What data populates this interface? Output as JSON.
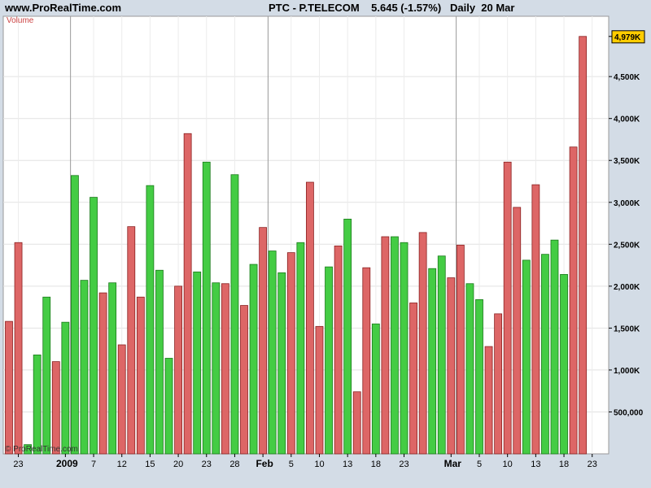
{
  "header": {
    "site": "www.ProRealTime.com",
    "title": "PTC - P.TELECOM    5.645 (-1.57%)   Daily  20 Mar"
  },
  "chart_data": {
    "type": "bar",
    "indicator_label": "Volume",
    "copyright": "© ProRealTime.com",
    "last_value_label": "4,979K",
    "ylim": [
      0,
      5200000
    ],
    "y_ticks": [
      {
        "value": 500000,
        "label": "500,000"
      },
      {
        "value": 1000000,
        "label": "1,000K"
      },
      {
        "value": 1500000,
        "label": "1,500K"
      },
      {
        "value": 2000000,
        "label": "2,000K"
      },
      {
        "value": 2500000,
        "label": "2,500K"
      },
      {
        "value": 3000000,
        "label": "3,000K"
      },
      {
        "value": 3500000,
        "label": "3,500K"
      },
      {
        "value": 4000000,
        "label": "4,000K"
      },
      {
        "value": 4500000,
        "label": "4,500K"
      }
    ],
    "x_ticks": [
      {
        "index": 1,
        "label": "23",
        "major": false
      },
      {
        "index": 6,
        "label": "2009",
        "major": true
      },
      {
        "index": 9,
        "label": "7",
        "major": false
      },
      {
        "index": 12,
        "label": "12",
        "major": false
      },
      {
        "index": 15,
        "label": "15",
        "major": false
      },
      {
        "index": 18,
        "label": "20",
        "major": false
      },
      {
        "index": 21,
        "label": "23",
        "major": false
      },
      {
        "index": 24,
        "label": "28",
        "major": false
      },
      {
        "index": 27,
        "label": "Feb",
        "major": true
      },
      {
        "index": 30,
        "label": "5",
        "major": false
      },
      {
        "index": 33,
        "label": "10",
        "major": false
      },
      {
        "index": 36,
        "label": "13",
        "major": false
      },
      {
        "index": 39,
        "label": "18",
        "major": false
      },
      {
        "index": 42,
        "label": "23",
        "major": false
      },
      {
        "index": 47,
        "label": "Mar",
        "major": true
      },
      {
        "index": 50,
        "label": "5",
        "major": false
      },
      {
        "index": 53,
        "label": "10",
        "major": false
      },
      {
        "index": 56,
        "label": "13",
        "major": false
      },
      {
        "index": 59,
        "label": "18",
        "major": false
      },
      {
        "index": 62,
        "label": "23",
        "major": false
      }
    ],
    "separators": [
      6,
      27,
      47
    ],
    "colors": {
      "up": "#44cc44",
      "down": "#dd6666",
      "up_edge": "#1a7a1a",
      "down_edge": "#8a2020"
    },
    "bars": [
      {
        "v": 1580000,
        "d": "down"
      },
      {
        "v": 2520000,
        "d": "down"
      },
      {
        "v": 110000,
        "d": "up"
      },
      {
        "v": 1180000,
        "d": "up"
      },
      {
        "v": 1870000,
        "d": "up"
      },
      {
        "v": 1100000,
        "d": "down"
      },
      {
        "v": 1570000,
        "d": "up"
      },
      {
        "v": 3320000,
        "d": "up"
      },
      {
        "v": 2070000,
        "d": "up"
      },
      {
        "v": 3060000,
        "d": "up"
      },
      {
        "v": 1920000,
        "d": "down"
      },
      {
        "v": 2040000,
        "d": "up"
      },
      {
        "v": 1300000,
        "d": "down"
      },
      {
        "v": 2710000,
        "d": "down"
      },
      {
        "v": 1870000,
        "d": "down"
      },
      {
        "v": 3200000,
        "d": "up"
      },
      {
        "v": 2190000,
        "d": "up"
      },
      {
        "v": 1140000,
        "d": "up"
      },
      {
        "v": 2000000,
        "d": "down"
      },
      {
        "v": 3820000,
        "d": "down"
      },
      {
        "v": 2170000,
        "d": "up"
      },
      {
        "v": 3480000,
        "d": "up"
      },
      {
        "v": 2040000,
        "d": "up"
      },
      {
        "v": 2030000,
        "d": "down"
      },
      {
        "v": 3330000,
        "d": "up"
      },
      {
        "v": 1770000,
        "d": "down"
      },
      {
        "v": 2260000,
        "d": "up"
      },
      {
        "v": 2700000,
        "d": "down"
      },
      {
        "v": 2420000,
        "d": "up"
      },
      {
        "v": 2160000,
        "d": "up"
      },
      {
        "v": 2400000,
        "d": "down"
      },
      {
        "v": 2520000,
        "d": "up"
      },
      {
        "v": 3240000,
        "d": "down"
      },
      {
        "v": 1520000,
        "d": "down"
      },
      {
        "v": 2230000,
        "d": "up"
      },
      {
        "v": 2480000,
        "d": "down"
      },
      {
        "v": 2800000,
        "d": "up"
      },
      {
        "v": 740000,
        "d": "down"
      },
      {
        "v": 2220000,
        "d": "down"
      },
      {
        "v": 1550000,
        "d": "up"
      },
      {
        "v": 2590000,
        "d": "down"
      },
      {
        "v": 2590000,
        "d": "up"
      },
      {
        "v": 2520000,
        "d": "up"
      },
      {
        "v": 1800000,
        "d": "down"
      },
      {
        "v": 2640000,
        "d": "down"
      },
      {
        "v": 2210000,
        "d": "up"
      },
      {
        "v": 2360000,
        "d": "up"
      },
      {
        "v": 2100000,
        "d": "down"
      },
      {
        "v": 2490000,
        "d": "down"
      },
      {
        "v": 2030000,
        "d": "up"
      },
      {
        "v": 1840000,
        "d": "up"
      },
      {
        "v": 1280000,
        "d": "down"
      },
      {
        "v": 1670000,
        "d": "down"
      },
      {
        "v": 3480000,
        "d": "down"
      },
      {
        "v": 2940000,
        "d": "down"
      },
      {
        "v": 2310000,
        "d": "up"
      },
      {
        "v": 3210000,
        "d": "down"
      },
      {
        "v": 2380000,
        "d": "up"
      },
      {
        "v": 2550000,
        "d": "up"
      },
      {
        "v": 2140000,
        "d": "up"
      },
      {
        "v": 3660000,
        "d": "down"
      },
      {
        "v": 4979000,
        "d": "down"
      }
    ]
  }
}
